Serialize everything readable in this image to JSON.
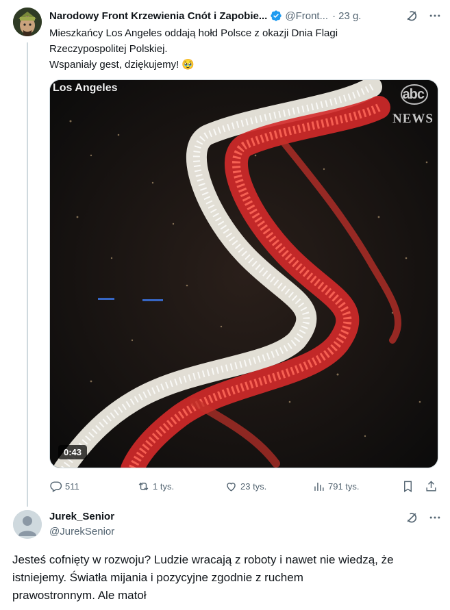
{
  "tweet": {
    "display_name": "Narodowy Front Krzewienia Cnót i Zapobie...",
    "handle": "@Front...",
    "separator": "·",
    "time": "23 g.",
    "text_lines": [
      "Mieszkańcy Los Angeles oddają hołd Polsce z okazji Dnia Flagi",
      "Rzeczypospolitej Polskiej.",
      "Wspaniały gest, dziękujemy! 🥹"
    ],
    "media": {
      "overlay_location": "Los Angeles",
      "overlay_brand": "abc",
      "overlay_news": "NEWS",
      "duration": "0:43"
    },
    "stats": {
      "replies": "511",
      "reposts": "1 tys.",
      "likes": "23 tys.",
      "views": "791 tys."
    },
    "icons": [
      "verified-badge-icon",
      "grok-icon",
      "more-icon",
      "reply-icon",
      "repost-icon",
      "like-icon",
      "views-icon",
      "bookmark-icon",
      "share-icon"
    ]
  },
  "reply": {
    "display_name": "Jurek_Senior",
    "handle": "@JurekSenior",
    "text_lines": [
      "Jesteś cofnięty w rozwoju? Ludzie wracają z roboty i nawet nie wiedzą, że",
      "istniejemy. Światła mijania i pozycyjne zgodnie z ruchem",
      "prawostronnym. Ale matoł"
    ]
  },
  "colors": {
    "text": "#0f1419",
    "secondary": "#536471",
    "verified": "#1d9bf0",
    "thread_line": "#cfd9de"
  }
}
